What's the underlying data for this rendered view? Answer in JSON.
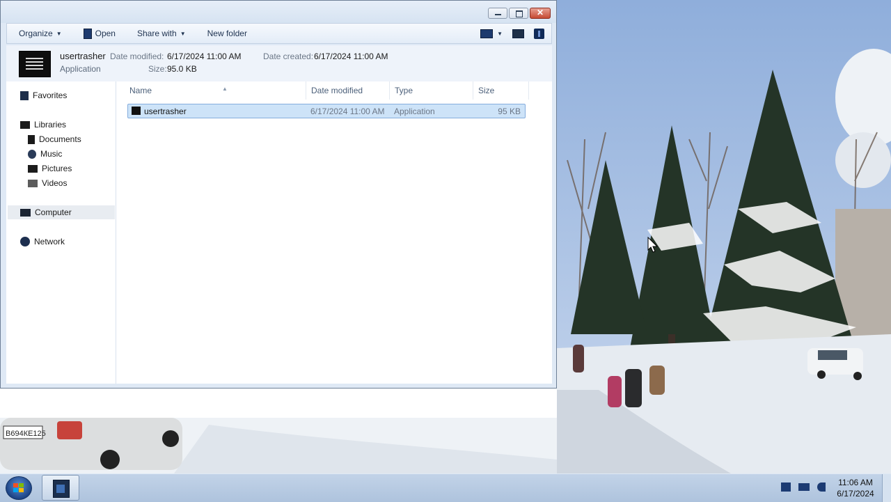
{
  "window": {
    "controls": {
      "minimize": "minimize",
      "maximize": "maximize",
      "close": "✕"
    }
  },
  "toolbar": {
    "organize": "Organize",
    "open": "Open",
    "share_with": "Share with",
    "new_folder": "New folder"
  },
  "details": {
    "name": "usertrasher",
    "type": "Application",
    "date_modified_label": "Date modified:",
    "date_modified": "6/17/2024 11:00 AM",
    "date_created_label": "Date created:",
    "date_created": "6/17/2024 11:00 AM",
    "size_label": "Size:",
    "size": "95.0 KB"
  },
  "nav": {
    "favorites": "Favorites",
    "libraries": "Libraries",
    "documents": "Documents",
    "music": "Music",
    "pictures": "Pictures",
    "videos": "Videos",
    "computer": "Computer",
    "network": "Network"
  },
  "columns": {
    "name": "Name",
    "date": "Date modified",
    "type": "Type",
    "size": "Size"
  },
  "files": [
    {
      "name": "usertrasher",
      "date": "6/17/2024 11:00 AM",
      "type": "Application",
      "size": "95 KB"
    }
  ],
  "taskbar": {
    "time": "11:06 AM",
    "date": "6/17/2024"
  },
  "wallpaper": {
    "plate": "В694КЕ125"
  },
  "colors": {
    "selection": "#cde3f8",
    "taskbar": "#b7cae2",
    "close_button": "#c64a33"
  }
}
